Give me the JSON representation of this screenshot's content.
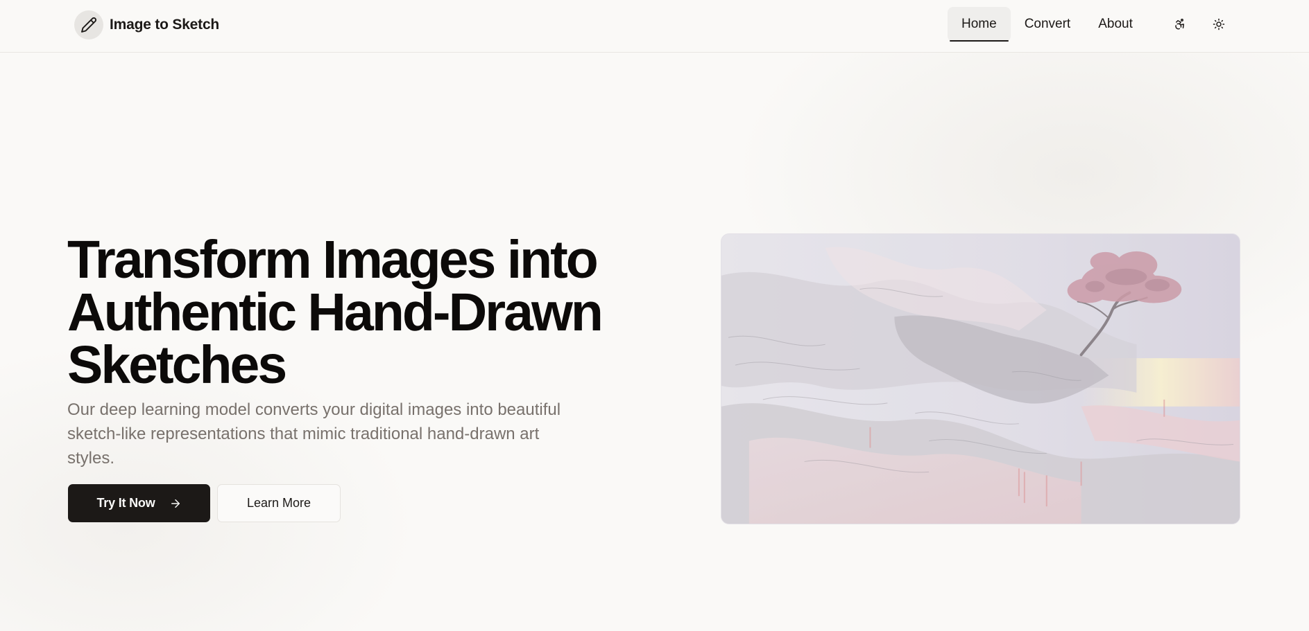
{
  "brand": {
    "name": "Image to Sketch",
    "logo_icon": "pencil-icon"
  },
  "nav": {
    "items": [
      {
        "label": "Home",
        "active": true
      },
      {
        "label": "Convert",
        "active": false
      },
      {
        "label": "About",
        "active": false
      }
    ],
    "accessibility_icon": "accessibility-icon",
    "theme_icon": "sun-icon"
  },
  "hero": {
    "title_lines": [
      "Transform Images into",
      "Authentic Hand-Drawn",
      "Sketches"
    ],
    "subtitle": "Our deep learning model converts your digital images into beautiful sketch-like representations that mimic traditional hand-drawn art styles.",
    "primary_button": "Try It Now",
    "primary_icon": "arrow-right-icon",
    "secondary_button": "Learn More"
  },
  "colors": {
    "background": "#faf9f7",
    "primary": "#1c1917",
    "muted_text": "#78716c",
    "border": "#e9e6e2"
  }
}
